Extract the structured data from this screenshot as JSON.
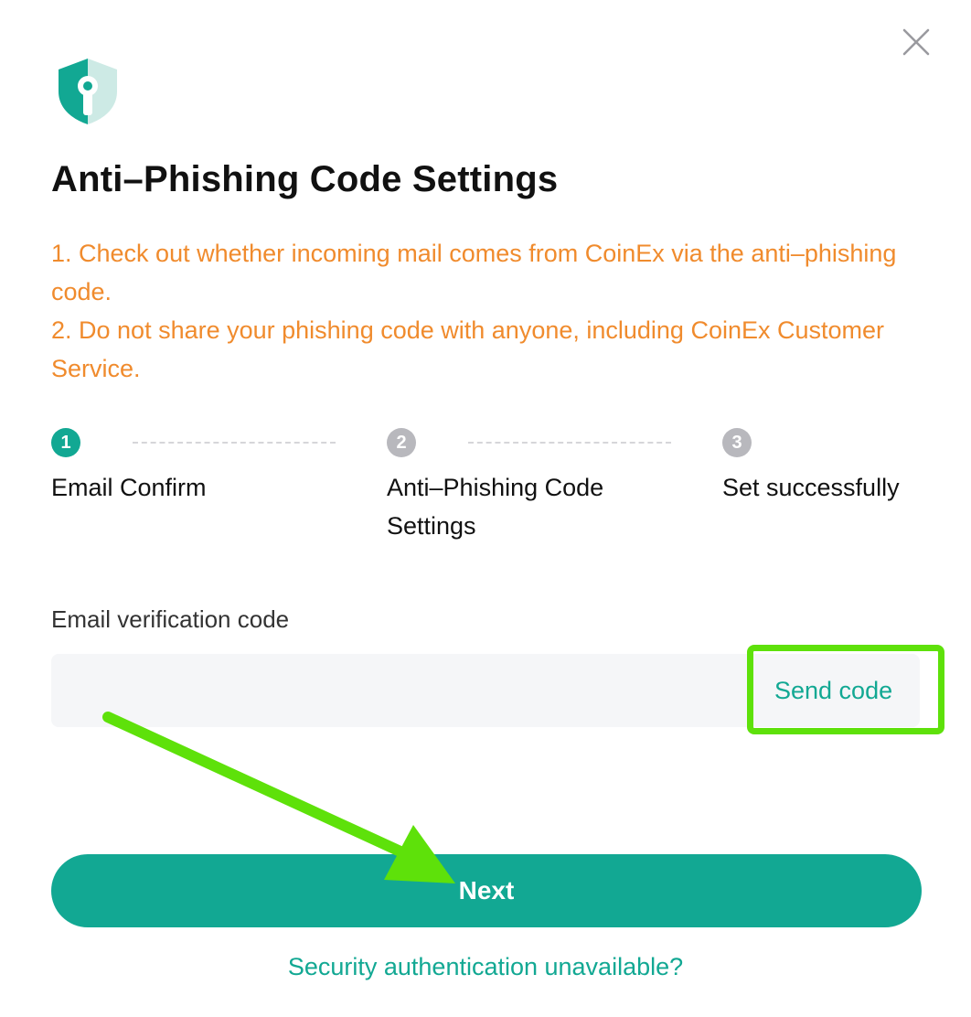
{
  "dialog": {
    "title": "Anti–Phishing Code Settings",
    "close_icon": "close-icon",
    "logo_icon": "shield-key-icon"
  },
  "notice": {
    "line1": "1. Check out whether incoming mail comes from CoinEx via the anti–phishing code.",
    "line2": "2. Do not share your phishing code with anyone, including CoinEx Customer Service."
  },
  "steps": [
    {
      "number": "1",
      "label": "Email Confirm",
      "state": "active"
    },
    {
      "number": "2",
      "label": "Anti–Phishing Code Settings",
      "state": "inactive"
    },
    {
      "number": "3",
      "label": "Set successfully",
      "state": "inactive"
    }
  ],
  "form": {
    "code_label": "Email verification code",
    "code_value": "",
    "code_placeholder": "",
    "send_code": "Send code"
  },
  "actions": {
    "next": "Next",
    "alt_link": "Security authentication unavailable?"
  },
  "colors": {
    "accent": "#12a893",
    "notice": "#f08b2d",
    "annotation": "#5ee10a",
    "step_inactive": "#b8b8bd"
  }
}
